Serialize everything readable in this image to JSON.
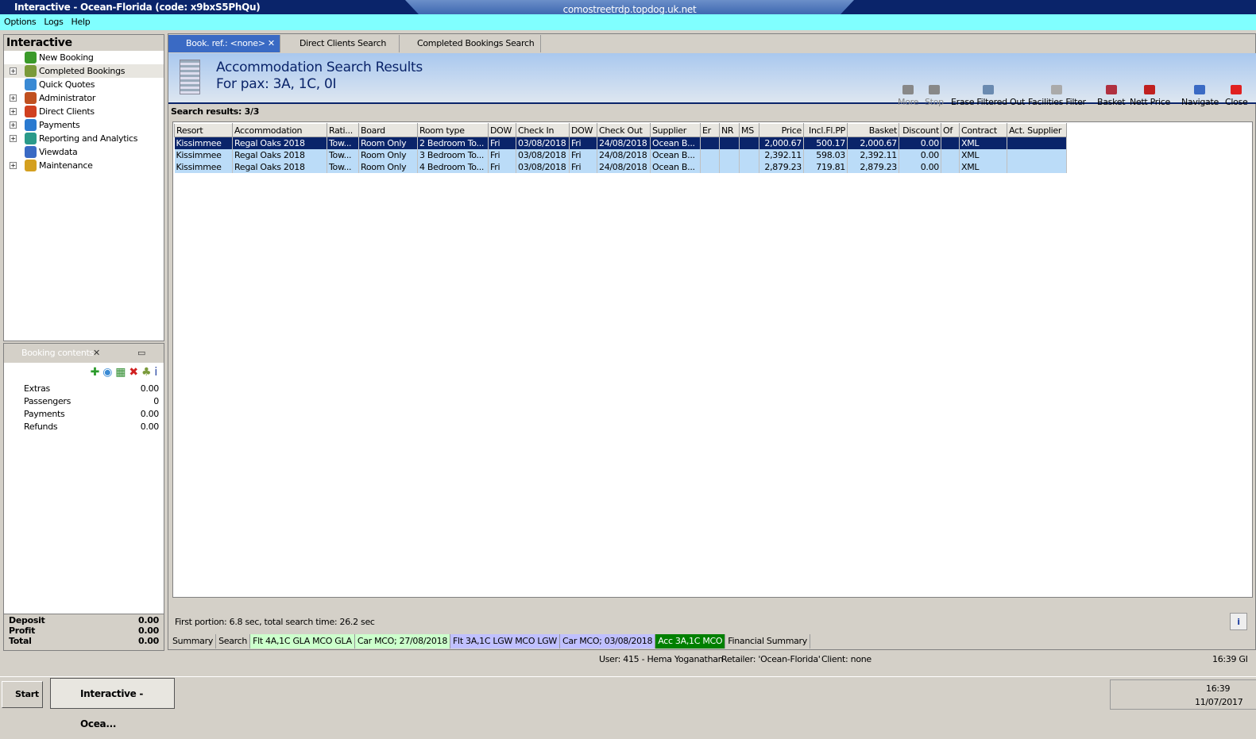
{
  "window": {
    "title": "Interactive - Ocean-Florida (code: x9bxS5PhQu)",
    "rdp_host": "comostreetrdp.topdog.uk.net"
  },
  "menu": [
    "Options",
    "Logs",
    "Help"
  ],
  "nav": {
    "title": "Interactive",
    "items": [
      {
        "label": "New Booking",
        "expand": false,
        "color": "#3a9a2a"
      },
      {
        "label": "Completed Bookings",
        "expand": true,
        "color": "#7a9a3a"
      },
      {
        "label": "Quick Quotes",
        "expand": false,
        "color": "#3a8ad4"
      },
      {
        "label": "Administrator",
        "expand": true,
        "color": "#c05020"
      },
      {
        "label": "Direct Clients",
        "expand": true,
        "color": "#d04020"
      },
      {
        "label": "Payments",
        "expand": true,
        "color": "#2a7ad0"
      },
      {
        "label": "Reporting and Analytics",
        "expand": true,
        "color": "#2a9a8a"
      },
      {
        "label": "Viewdata",
        "expand": false,
        "color": "#3a6ac4"
      },
      {
        "label": "Maintenance",
        "expand": true,
        "color": "#d4a020"
      }
    ]
  },
  "booking_contents": {
    "title": "Booking contents",
    "rows": [
      {
        "label": "Extras",
        "value": "0.00"
      },
      {
        "label": "Passengers",
        "value": "0"
      },
      {
        "label": "Payments",
        "value": "0.00"
      },
      {
        "label": "Refunds",
        "value": "0.00"
      }
    ],
    "totals": [
      {
        "label": "Deposit",
        "value": "0.00"
      },
      {
        "label": "Profit",
        "value": "0.00"
      },
      {
        "label": "Total",
        "value": "0.00"
      }
    ]
  },
  "tabs": [
    "Book. ref.: <none>",
    "Direct Clients Search",
    "Completed Bookings Search"
  ],
  "banner": {
    "title": "Accommodation Search Results",
    "subtitle": "For pax: 3A, 1C, 0I"
  },
  "toolbar": [
    "More",
    "Stop",
    "Erase Filtered Out",
    "Facilities Filter",
    "Basket",
    "Nett Price",
    "Navigate",
    "Close"
  ],
  "results_label": "Search results: 3/3",
  "columns": [
    "Resort",
    "Accommodation",
    "Rati...",
    "Board",
    "Room type",
    "DOW",
    "Check In",
    "DOW",
    "Check Out",
    "Supplier",
    "Er",
    "NR",
    "MS",
    "Price",
    "Incl.Fl.PP",
    "Basket",
    "Discount",
    "Of",
    "Contract",
    "Act. Supplier"
  ],
  "rows": [
    [
      "Kissimmee",
      "Regal Oaks 2018",
      "Tow...",
      "Room Only",
      "2 Bedroom To...",
      "Fri",
      "03/08/2018",
      "Fri",
      "24/08/2018",
      "Ocean B...",
      "",
      "",
      "",
      "2,000.67",
      "500.17",
      "2,000.67",
      "0.00",
      "",
      "XML",
      ""
    ],
    [
      "Kissimmee",
      "Regal Oaks 2018",
      "Tow...",
      "Room Only",
      "3 Bedroom To...",
      "Fri",
      "03/08/2018",
      "Fri",
      "24/08/2018",
      "Ocean B...",
      "",
      "",
      "",
      "2,392.11",
      "598.03",
      "2,392.11",
      "0.00",
      "",
      "XML",
      ""
    ],
    [
      "Kissimmee",
      "Regal Oaks 2018",
      "Tow...",
      "Room Only",
      "4 Bedroom To...",
      "Fri",
      "03/08/2018",
      "Fri",
      "24/08/2018",
      "Ocean B...",
      "",
      "",
      "",
      "2,879.23",
      "719.81",
      "2,879.23",
      "0.00",
      "",
      "XML",
      ""
    ]
  ],
  "search_time": "First portion: 6.8 sec, total search time: 26.2 sec",
  "bottom_tabs": [
    {
      "label": "Summary",
      "color": "#d4d0c8",
      "fg": "#000"
    },
    {
      "label": "Search",
      "color": "#d4d0c8",
      "fg": "#000"
    },
    {
      "label": "Flt 4A,1C GLA MCO GLA",
      "color": "#ccffcc",
      "fg": "#000"
    },
    {
      "label": "Car MCO; 27/08/2018",
      "color": "#ccffcc",
      "fg": "#000"
    },
    {
      "label": "Flt 3A,1C LGW MCO LGW",
      "color": "#c0c0ff",
      "fg": "#000"
    },
    {
      "label": "Car MCO; 03/08/2018",
      "color": "#c0c0ff",
      "fg": "#000"
    },
    {
      "label": "Acc 3A,1C MCO",
      "color": "#008000",
      "fg": "#fff"
    },
    {
      "label": "Financial Summary",
      "color": "#d4d0c8",
      "fg": "#000"
    }
  ],
  "status": {
    "user": "User: 415 - Hema Yoganathan",
    "retailer": "Retailer: 'Ocean-Florida'",
    "client": "Client: none",
    "time": "16:39 GI"
  },
  "taskbar": {
    "start": "Start",
    "task": "Interactive - Ocea...",
    "clock_time": "16:39",
    "clock_date": "11/07/2017"
  }
}
